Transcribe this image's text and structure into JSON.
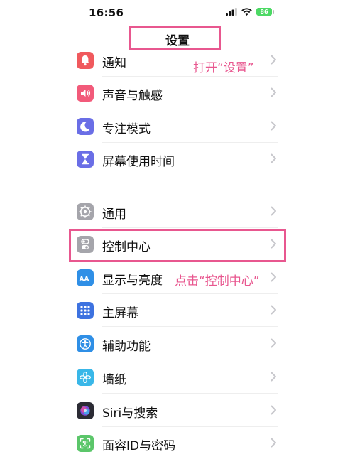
{
  "status_bar": {
    "time": "16:56",
    "battery_level": "86"
  },
  "nav": {
    "title": "设置"
  },
  "annotations": {
    "open_settings": "打开“设置”",
    "tap_control_center": "点击“控制中心”"
  },
  "colors": {
    "highlight": "#e8578f",
    "chevron": "#c7c7cc"
  },
  "settings_groups": [
    {
      "items": [
        {
          "label": "通知",
          "icon": "bell-icon",
          "color": "#f0595d"
        },
        {
          "label": "声音与触感",
          "icon": "speaker-icon",
          "color": "#f25a7a"
        },
        {
          "label": "专注模式",
          "icon": "moon-icon",
          "color": "#6a6ee6"
        },
        {
          "label": "屏幕使用时间",
          "icon": "hourglass-icon",
          "color": "#6a6ee6"
        }
      ]
    },
    {
      "items": [
        {
          "label": "通用",
          "icon": "gear-icon",
          "color": "#a5a5ab"
        },
        {
          "label": "控制中心",
          "icon": "toggles-icon",
          "color": "#a5a5ab"
        },
        {
          "label": "显示与亮度",
          "icon": "text-size-icon",
          "color": "#2f8fe6"
        },
        {
          "label": "主屏幕",
          "icon": "home-grid-icon",
          "color": "#3d72e0"
        },
        {
          "label": "辅助功能",
          "icon": "accessibility-icon",
          "color": "#2f8fe6"
        },
        {
          "label": "墙纸",
          "icon": "flower-icon",
          "color": "#39b7e8"
        },
        {
          "label": "Siri与搜索",
          "icon": "siri-icon",
          "color": "#2b2b34"
        },
        {
          "label": "面容ID与密码",
          "icon": "face-id-icon",
          "color": "#5bc66a"
        }
      ]
    }
  ]
}
